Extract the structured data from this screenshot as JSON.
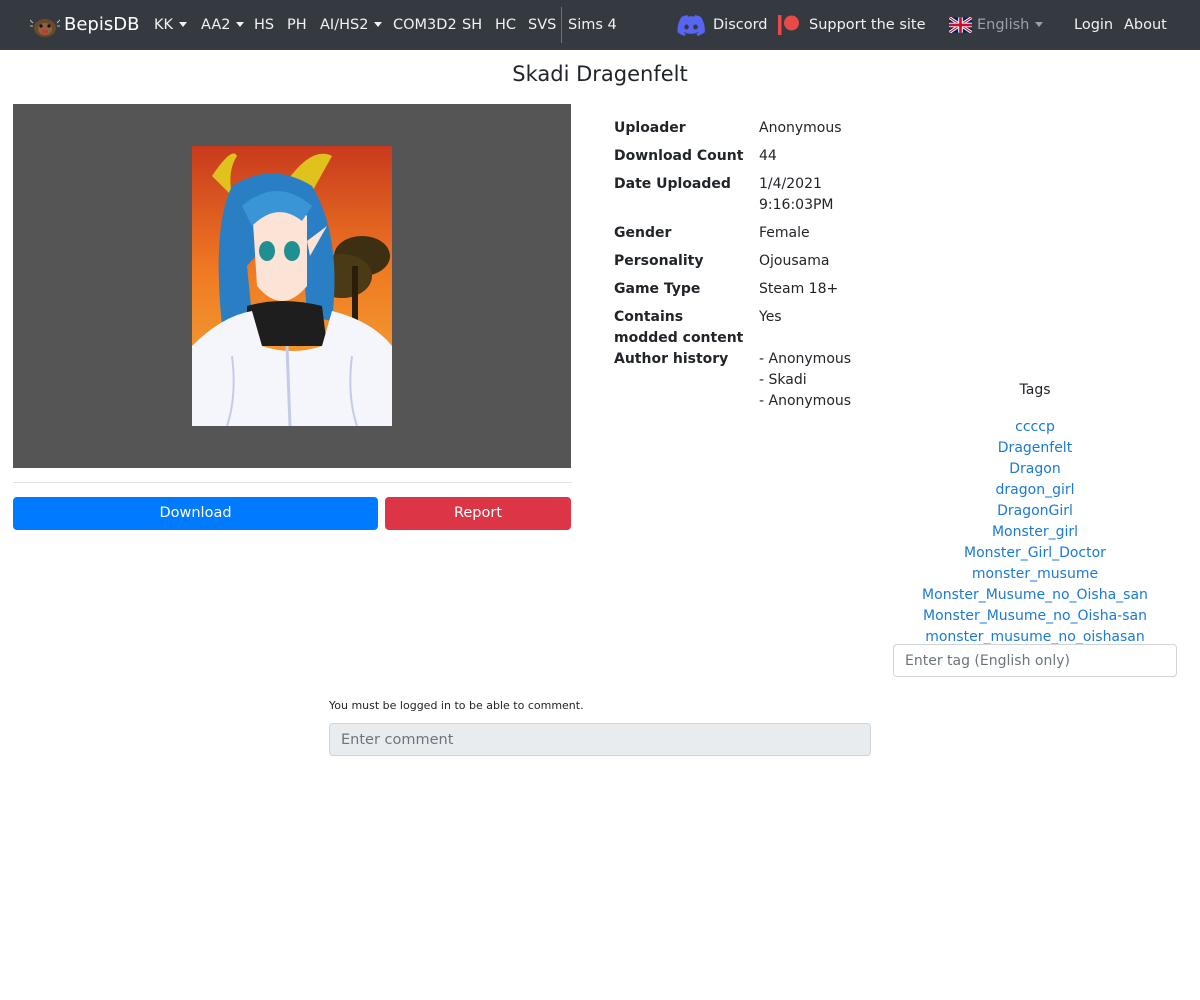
{
  "nav": {
    "brand": "BepisDB",
    "items": [
      {
        "label": "KK",
        "dropdown": true
      },
      {
        "label": "AA2",
        "dropdown": true
      },
      {
        "label": "HS",
        "dropdown": false
      },
      {
        "label": "PH",
        "dropdown": false
      },
      {
        "label": "AI/HS2",
        "dropdown": true
      },
      {
        "label": "COM3D2",
        "dropdown": false
      },
      {
        "label": "SH",
        "dropdown": false
      },
      {
        "label": "HC",
        "dropdown": false
      },
      {
        "label": "SVS",
        "dropdown": false
      },
      {
        "label": "Sims 4",
        "dropdown": false
      }
    ],
    "discord": "Discord",
    "support": "Support the site",
    "language": "English",
    "login": "Login",
    "about": "About",
    "colors": {
      "bar": "#343a40",
      "discord": "#5865F2",
      "patreon": "#e84a4a"
    }
  },
  "page": {
    "title": "Skadi Dragenfelt"
  },
  "actions": {
    "download": "Download",
    "report": "Report"
  },
  "info": {
    "uploader_label": "Uploader",
    "uploader": "Anonymous",
    "download_count_label": "Download Count",
    "download_count": "44",
    "date_label": "Date Uploaded",
    "date": "1/4/2021",
    "time": "9:16:03PM",
    "gender_label": "Gender",
    "gender": "Female",
    "personality_label": "Personality",
    "personality": "Ojousama",
    "game_type_label": "Game Type",
    "game_type": "Steam 18+",
    "modded_label_1": "Contains",
    "modded_label_2": "modded content",
    "modded": "Yes",
    "author_history_label": "Author history",
    "author_history": [
      "- Anonymous",
      "- Skadi",
      "- Anonymous"
    ]
  },
  "tags": {
    "title": "Tags",
    "items": [
      "ccccp",
      "Dragenfelt",
      "Dragon",
      "dragon_girl",
      "DragonGirl",
      "Monster_girl",
      "Monster_Girl_Doctor",
      "monster_musume",
      "Monster_Musume_no_Oisha_san",
      "Monster_Musume_no_Oisha-san",
      "monster_musume_no_oishasan"
    ],
    "input_placeholder": "Enter tag (English only)"
  },
  "comments": {
    "notice": "You must be logged in to be able to comment.",
    "input_placeholder": "Enter comment"
  },
  "colors": {
    "primary": "#007bff",
    "danger": "#dc3545",
    "link": "#1a7ad4",
    "image_bg": "#555555"
  }
}
